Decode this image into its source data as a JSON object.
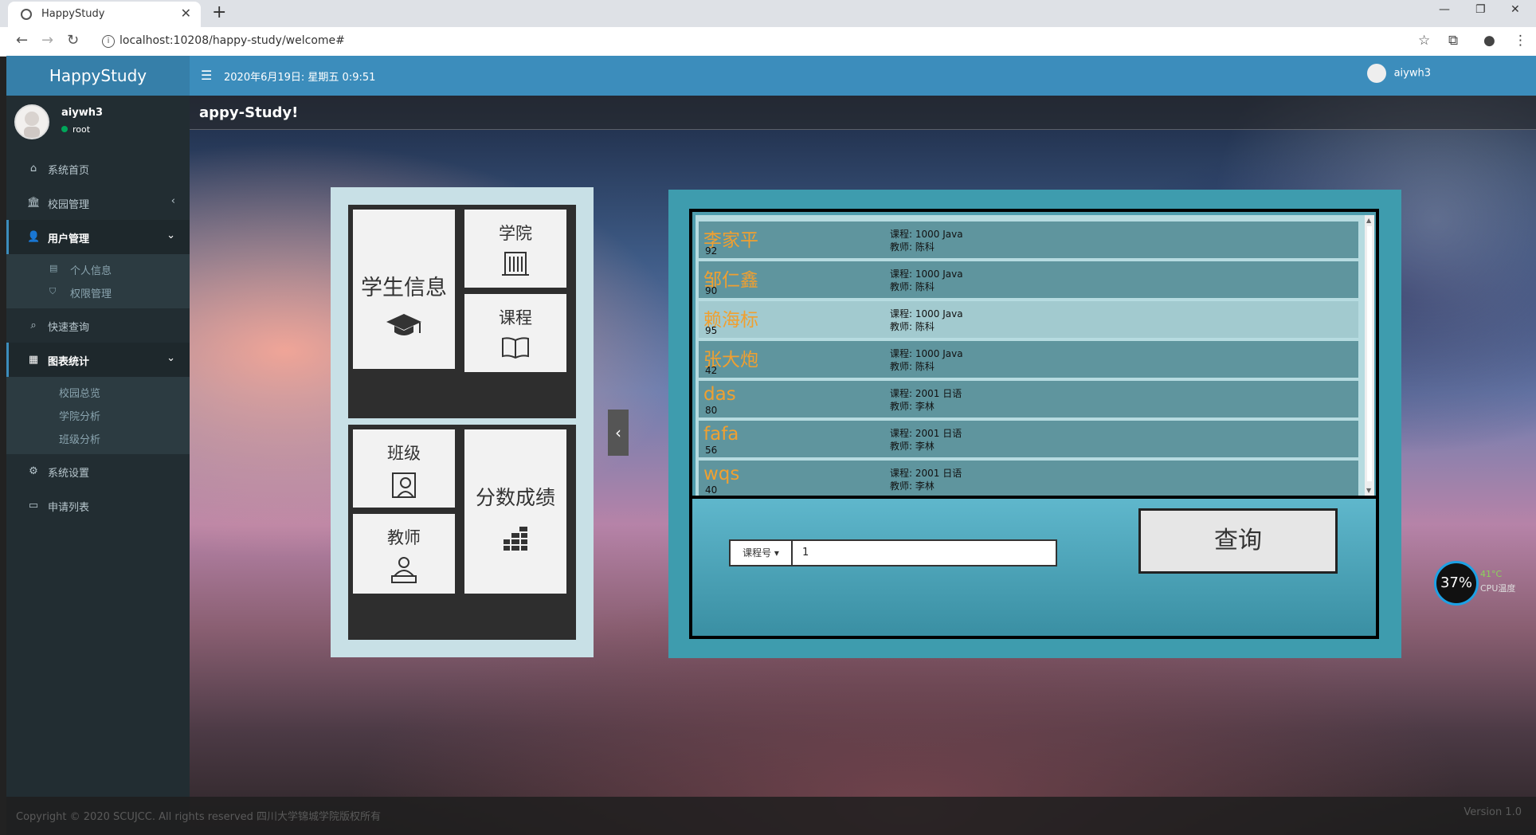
{
  "browser": {
    "tab_title": "HappyStudy",
    "url": "localhost:10208/happy-study/welcome#"
  },
  "sidebar": {
    "logo": "HappyStudy",
    "user_name": "aiywh3",
    "user_role": "root",
    "items": [
      {
        "label": "系统首页",
        "icon": "home-icon"
      },
      {
        "label": "校园管理",
        "icon": "bank-icon"
      },
      {
        "label": "用户管理",
        "icon": "user-icon"
      },
      {
        "label": "个人信息",
        "icon": "profile-icon"
      },
      {
        "label": "权限管理",
        "icon": "shield-icon"
      },
      {
        "label": "快速查询",
        "icon": "search-icon"
      },
      {
        "label": "图表统计",
        "icon": "chart-icon"
      },
      {
        "label": "校园总览"
      },
      {
        "label": "学院分析"
      },
      {
        "label": "班级分析"
      },
      {
        "label": "系统设置",
        "icon": "gear-icon"
      },
      {
        "label": "申请列表",
        "icon": "message-icon"
      }
    ]
  },
  "header": {
    "date": "2020年6月19日: 星期五 0:9:51",
    "user_name": "aiywh3"
  },
  "content": {
    "title": "appy-Study!",
    "tiles": {
      "student": "学生信息",
      "college": "学院",
      "course": "课程",
      "class": "班级",
      "teacher": "教师",
      "score": "分数成绩"
    },
    "results": [
      {
        "name": "李家平",
        "score": "92",
        "course": "课程: 1000 Java",
        "teacher": "教师: 陈科"
      },
      {
        "name": "邹仁鑫",
        "score": "90",
        "course": "课程: 1000 Java",
        "teacher": "教师: 陈科"
      },
      {
        "name": "赖海标",
        "score": "95",
        "course": "课程: 1000 Java",
        "teacher": "教师: 陈科"
      },
      {
        "name": "张大炮",
        "score": "42",
        "course": "课程: 1000 Java",
        "teacher": "教师: 陈科"
      },
      {
        "name": "das",
        "score": "80",
        "course": "课程: 2001 日语",
        "teacher": "教师: 李林"
      },
      {
        "name": "fafa",
        "score": "56",
        "course": "课程: 2001 日语",
        "teacher": "教师: 李林"
      },
      {
        "name": "wqs",
        "score": "40",
        "course": "课程: 2001 日语",
        "teacher": "教师: 李林"
      }
    ],
    "search": {
      "select_label": "课程号",
      "input_value": "1",
      "button_label": "查询"
    }
  },
  "footer": {
    "copyright": "Copyright © 2020 SCUJCC. All rights reserved 四川大学锦城学院版权所有",
    "version": "Version 1.0"
  },
  "cpu_widget": {
    "percent": "37%",
    "temperature": "41°C",
    "label": "CPU温度"
  }
}
